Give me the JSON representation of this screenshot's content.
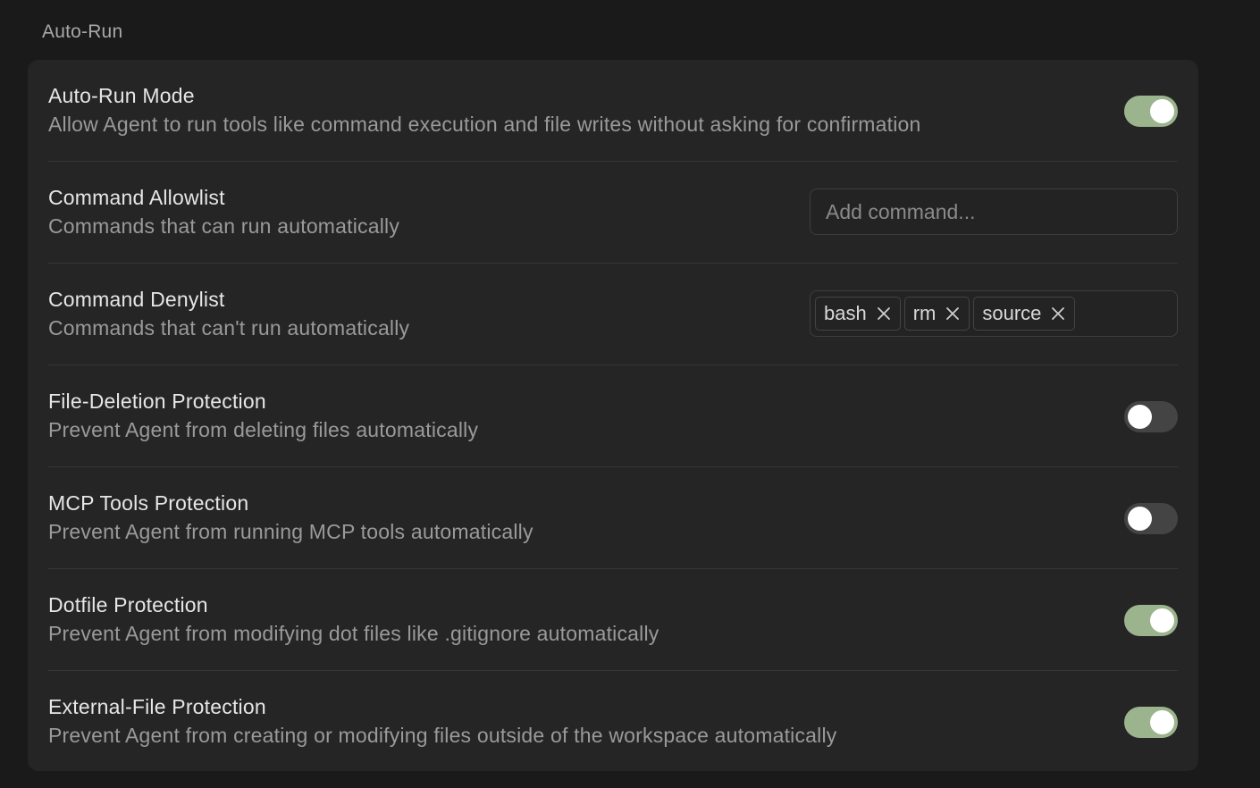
{
  "section": {
    "title": "Auto-Run"
  },
  "rows": [
    {
      "title": "Auto-Run Mode",
      "desc": "Allow Agent to run tools like command execution and file writes without asking for confirmation",
      "toggle": "on"
    },
    {
      "title": "Command Allowlist",
      "desc": "Commands that can run automatically",
      "input_placeholder": "Add command..."
    },
    {
      "title": "Command Denylist",
      "desc": "Commands that can't run automatically",
      "tags": [
        "bash",
        "rm",
        "source"
      ]
    },
    {
      "title": "File-Deletion Protection",
      "desc": "Prevent Agent from deleting files automatically",
      "toggle": "off"
    },
    {
      "title": "MCP Tools Protection",
      "desc": "Prevent Agent from running MCP tools automatically",
      "toggle": "off"
    },
    {
      "title": "Dotfile Protection",
      "desc": "Prevent Agent from modifying dot files like .gitignore automatically",
      "toggle": "on"
    },
    {
      "title": "External-File Protection",
      "desc": "Prevent Agent from creating or modifying files outside of the workspace automatically",
      "toggle": "on"
    }
  ],
  "colors": {
    "background": "#1a1a1a",
    "panel": "#252525",
    "toggle_on": "#9cb48e",
    "toggle_off": "#444444"
  },
  "icons": {
    "tag_remove": "close-icon"
  }
}
